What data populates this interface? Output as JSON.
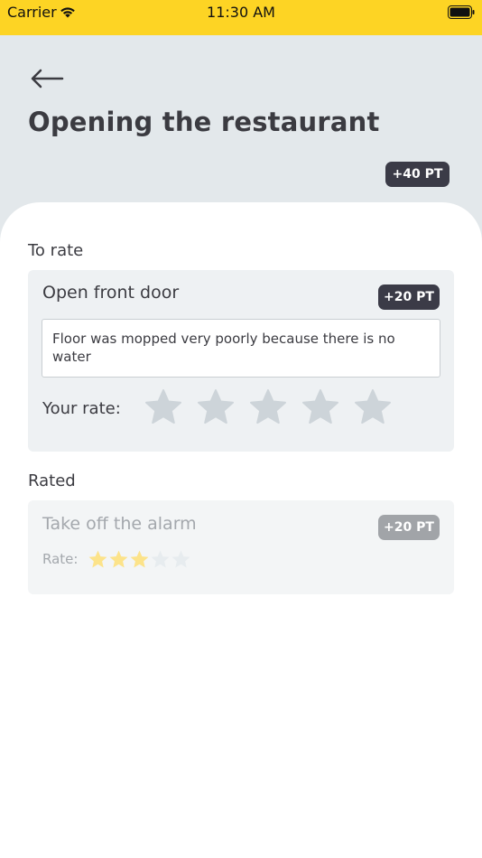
{
  "status_bar": {
    "carrier": "Carrier",
    "time": "11:30 AM"
  },
  "header": {
    "title": "Opening the restaurant",
    "total_points": "+40 PT"
  },
  "to_rate": {
    "label": "To rate",
    "task": {
      "name": "Open front door",
      "points": "+20 PT",
      "comment": "Floor was mopped very poorly because there is no water",
      "rate_label": "Your rate:",
      "stars_total": 5,
      "stars_selected": 0
    }
  },
  "rated": {
    "label": "Rated",
    "task": {
      "name": "Take off the alarm",
      "points": "+20 PT",
      "rate_label": "Rate:",
      "rating": 3,
      "stars_total": 5
    }
  },
  "colors": {
    "status_bar": "#fdd424",
    "header_bg": "#e3e8eb",
    "badge_dark": "#3b3b47",
    "badge_muted": "#a1a4a8",
    "star_empty": "#cdd4d9",
    "star_filled": "#fce38a"
  }
}
